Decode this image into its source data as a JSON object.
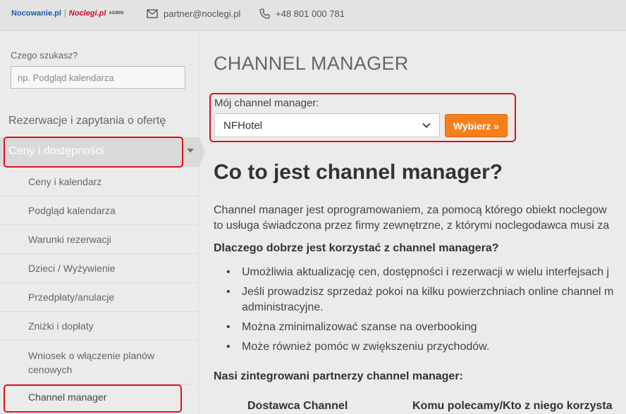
{
  "header": {
    "logo_primary": "Nocowanie.pl",
    "logo_separator": "|",
    "logo_secondary": "Noclegi.pl",
    "logo_admin": "ADMIN",
    "email_icon": "envelope-icon",
    "email": "partner@noclegi.pl",
    "phone_icon": "phone-icon",
    "phone": "+48 801 000 781"
  },
  "sidebar": {
    "search_label": "Czego szukasz?",
    "search_placeholder": "np. Podgląd kalendarza",
    "section_reservations": "Rezerwacje i zapytania o ofertę",
    "section_prices": "Ceny i dostępności",
    "items": [
      {
        "label": "Ceny i kalendarz"
      },
      {
        "label": "Podgląd kalendarza"
      },
      {
        "label": "Warunki rezerwacji"
      },
      {
        "label": "Dzieci / Wyżywienie"
      },
      {
        "label": "Przedpłaty/anulacje"
      },
      {
        "label": "Zniżki i dopłaty"
      },
      {
        "label": "Wniosek o włączenie planów cenowych"
      },
      {
        "label": "Channel manager"
      }
    ]
  },
  "main": {
    "page_title": "CHANNEL MANAGER",
    "my_cm_label": "Mój channel manager:",
    "selected_cm": "NFHotel",
    "choose_button": "Wybierz »",
    "heading": "Co to jest channel manager?",
    "intro_line1": "Channel manager jest oprogramowaniem, za pomocą którego obiekt noclegow",
    "intro_line2": "to usługa świadczona przez firmy zewnętrzne, z którymi noclegodawca musi za",
    "why_heading": "Dlaczego dobrze jest korzystać z channel managera?",
    "bullets": [
      "Umożliwia aktualizację cen, dostępności i rezerwacji w wielu interfejsach j",
      "Jeśli prowadzisz sprzedaż pokoi na kilku powierzchniach online channel m",
      "Można zminimalizować szanse na overbooking",
      "Może również pomóc w zwiększeniu przychodów."
    ],
    "bullet2_line2": "administracyjne.",
    "partners_heading": "Nasi zintegrowani partnerzy channel manager:",
    "table_col1": "Dostawca Channel",
    "table_col2": "Komu polecamy/Kto z niego korzysta"
  },
  "colors": {
    "highlight": "#e0101a",
    "button": "#f77f1a",
    "logo_primary": "#1d5aa8",
    "logo_secondary": "#c8102e"
  }
}
